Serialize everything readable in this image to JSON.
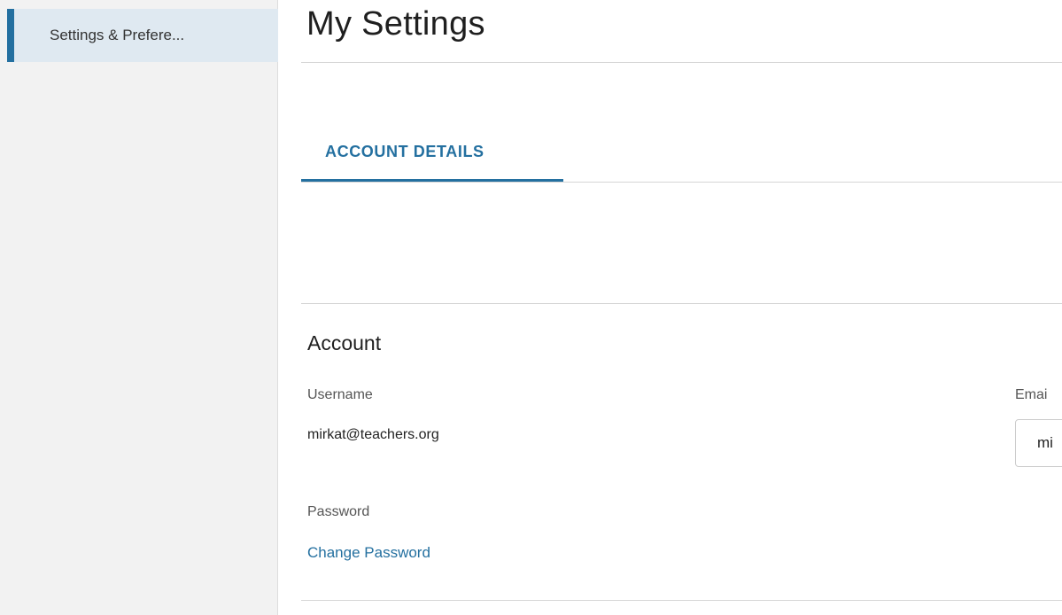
{
  "sidebar": {
    "items": [
      {
        "label": "Settings & Prefere..."
      }
    ]
  },
  "page": {
    "title": "My Settings"
  },
  "tabs": [
    {
      "label": "ACCOUNT DETAILS",
      "active": true
    }
  ],
  "account": {
    "section_title": "Account",
    "username_label": "Username",
    "username_value": "mirkat@teachers.org",
    "password_label": "Password",
    "change_password_link": "Change Password",
    "email_label": "Emai",
    "email_value": "mi"
  },
  "colors": {
    "accent": "#2470a0",
    "sidebar_bg": "#f2f2f2",
    "sidebar_active_bg": "#dfe9f1"
  }
}
